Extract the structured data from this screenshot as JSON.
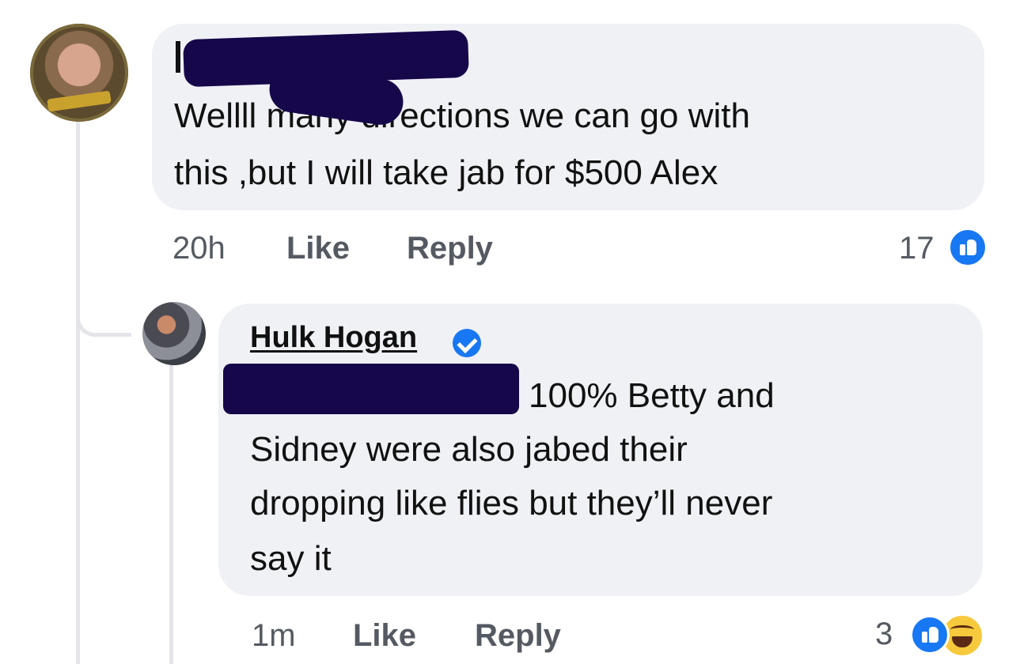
{
  "comment": {
    "text_line1": "Wellll many directions we can go with",
    "text_line2": "this ,but I will take jab for $500 Alex",
    "time": "20h",
    "like_label": "Like",
    "reply_label": "Reply",
    "reaction_count": "17",
    "reactions": [
      "like-icon"
    ]
  },
  "reply": {
    "author": "Hulk Hogan",
    "verified": true,
    "text_line1": "100% Betty and",
    "text_line2": "Sidney were also jabed their",
    "text_line3": "dropping like flies but they’ll never",
    "text_line4": "say it",
    "time": "1m",
    "like_label": "Like",
    "reply_label": "Reply",
    "reaction_count": "3",
    "reactions": [
      "like-icon",
      "haha-icon"
    ]
  },
  "colors": {
    "bubble": "#eff1f5",
    "redaction": "#16064a",
    "facebook_blue": "#1877f2",
    "meta_text": "#555a62"
  }
}
